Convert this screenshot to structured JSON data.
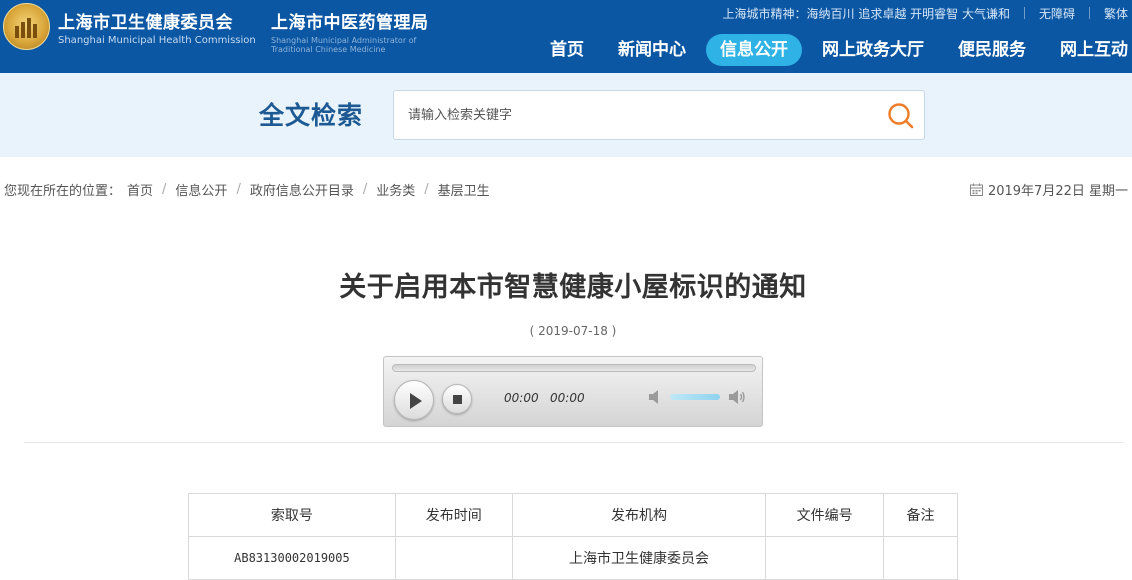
{
  "header": {
    "org1_cn": "上海市卫生健康委员会",
    "org1_en": "Shanghai Municipal Health Commission",
    "org2_cn": "上海市中医药管理局",
    "org2_en_line1": "Shanghai Municipal Administrator of",
    "org2_en_line2": "Traditional Chinese Medicine",
    "emblem_icon": "emblem-icon",
    "top_links": {
      "slogan": "上海城市精神：海纳百川 追求卓越 开明睿智 大气谦和",
      "accessibility": "无障碍",
      "traditional": "繁体"
    },
    "nav": [
      {
        "label": "首页",
        "active": false
      },
      {
        "label": "新闻中心",
        "active": false
      },
      {
        "label": "信息公开",
        "active": true
      },
      {
        "label": "网上政务大厅",
        "active": false
      },
      {
        "label": "便民服务",
        "active": false
      },
      {
        "label": "网上互动",
        "active": false
      }
    ],
    "colors": {
      "bar": "#0b57a4",
      "active_tab": "#2fb2e5"
    }
  },
  "search": {
    "title": "全文检索",
    "placeholder": "请输入检索关键字",
    "button_icon": "search-icon",
    "accent": "#ee7d2a"
  },
  "breadcrumb": {
    "prefix": "您现在所在的位置：",
    "items": [
      "首页",
      "信息公开",
      "政府信息公开目录",
      "业务类",
      "基层卫生"
    ],
    "separator": "/",
    "date_icon": "calendar-icon",
    "date": "2019年7月22日 星期一"
  },
  "article": {
    "title": "关于启用本市智慧健康小屋标识的通知",
    "date": "( 2019-07-18 )"
  },
  "player": {
    "current_time": "00:00",
    "duration": "00:00",
    "volume_level": 0.7
  },
  "info_table": {
    "headers": [
      "索取号",
      "发布时间",
      "发布机构",
      "文件编号",
      "备注"
    ],
    "rows": [
      [
        "AB83130002019005",
        "",
        "上海市卫生健康委员会",
        "",
        ""
      ]
    ]
  }
}
